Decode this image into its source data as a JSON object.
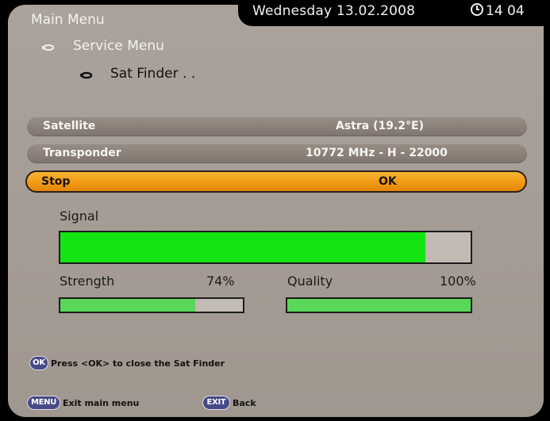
{
  "header": {
    "date": "Wednesday 13.02.2008",
    "time": "14 04"
  },
  "breadcrumb": {
    "level1": "Main Menu",
    "level2": "Service Menu",
    "level3": "Sat Finder . ."
  },
  "settings": [
    {
      "label": "Satellite",
      "value": "Astra (19.2°E)"
    },
    {
      "label": "Transponder",
      "value": "10772 MHz - H - 22000"
    }
  ],
  "selected_row": {
    "label": "Stop",
    "value": "OK"
  },
  "signal": {
    "label": "Signal",
    "level": 0.89
  },
  "strength": {
    "label": "Strength",
    "value_text": "74%",
    "level": 0.74
  },
  "quality": {
    "label": "Quality",
    "value_text": "100%",
    "level": 1.0
  },
  "footer": {
    "ok_key": "OK",
    "ok_hint": "Press <OK> to close the Sat Finder",
    "menu_key": "MENU",
    "menu_hint": "Exit main menu",
    "exit_key": "EXIT",
    "exit_hint": "Back"
  },
  "colors": {
    "selected_row": "#f29a15",
    "bar_green": "#13e513",
    "key_button": "#454a86"
  }
}
